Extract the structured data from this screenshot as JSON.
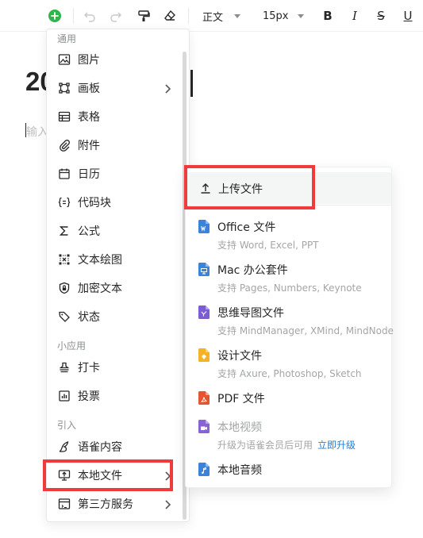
{
  "toolbar": {
    "paragraph_style": "正文",
    "font_size": "15px",
    "bold": "B",
    "italic": "I",
    "strikethrough": "S",
    "underline": "U",
    "add_color": "#2fb54a"
  },
  "editor": {
    "title": "20",
    "placeholder": "输入"
  },
  "menu": {
    "groups": {
      "common": "通用",
      "mini_apps": "小应用",
      "import": "引入"
    },
    "items": [
      {
        "label": "图片",
        "icon": "image-icon"
      },
      {
        "label": "画板",
        "icon": "board-icon",
        "has_submenu": true
      },
      {
        "label": "表格",
        "icon": "table-icon"
      },
      {
        "label": "附件",
        "icon": "paperclip-icon"
      },
      {
        "label": "日历",
        "icon": "calendar-icon"
      },
      {
        "label": "代码块",
        "icon": "code-block-icon"
      },
      {
        "label": "公式",
        "icon": "sigma-icon"
      },
      {
        "label": "文本绘图",
        "icon": "text-diagram-icon"
      },
      {
        "label": "加密文本",
        "icon": "lock-icon"
      },
      {
        "label": "状态",
        "icon": "tag-icon"
      },
      {
        "label": "打卡",
        "icon": "stamp-icon"
      },
      {
        "label": "投票",
        "icon": "vote-icon"
      },
      {
        "label": "语雀内容",
        "icon": "yuque-icon"
      },
      {
        "label": "本地文件",
        "icon": "local-file-icon",
        "has_submenu": true,
        "highlighted": true
      },
      {
        "label": "第三方服务",
        "icon": "third-party-icon",
        "has_submenu": true
      }
    ]
  },
  "submenu": {
    "upload": {
      "label": "上传文件",
      "icon": "upload-icon"
    },
    "items": [
      {
        "label": "Office 文件",
        "desc": "支持 Word, Excel, PPT",
        "color": "#3b82d9",
        "icon": "office-file-icon"
      },
      {
        "label": "Mac 办公套件",
        "desc": "支持 Pages, Numbers, Keynote",
        "color": "#3b82d9",
        "icon": "mac-office-icon"
      },
      {
        "label": "思维导图文件",
        "desc": "支持 MindManager, XMind, MindNode",
        "color": "#7b5cd6",
        "icon": "mindmap-file-icon"
      },
      {
        "label": "设计文件",
        "desc": "支持 Axure, Photoshop, Sketch",
        "color": "#f5b227",
        "icon": "design-file-icon"
      },
      {
        "label": "PDF 文件",
        "desc": "",
        "color": "#e4572e",
        "icon": "pdf-file-icon"
      },
      {
        "label": "本地视频",
        "desc": "升级为语雀会员后可用",
        "link": "立即升级",
        "color": "#8a63d2",
        "icon": "video-file-icon"
      },
      {
        "label": "本地音频",
        "desc": "",
        "color": "#3b82d9",
        "icon": "audio-file-icon"
      }
    ]
  },
  "colors": {
    "highlight_border": "#ef3b3b",
    "link": "#1f7fd8"
  }
}
